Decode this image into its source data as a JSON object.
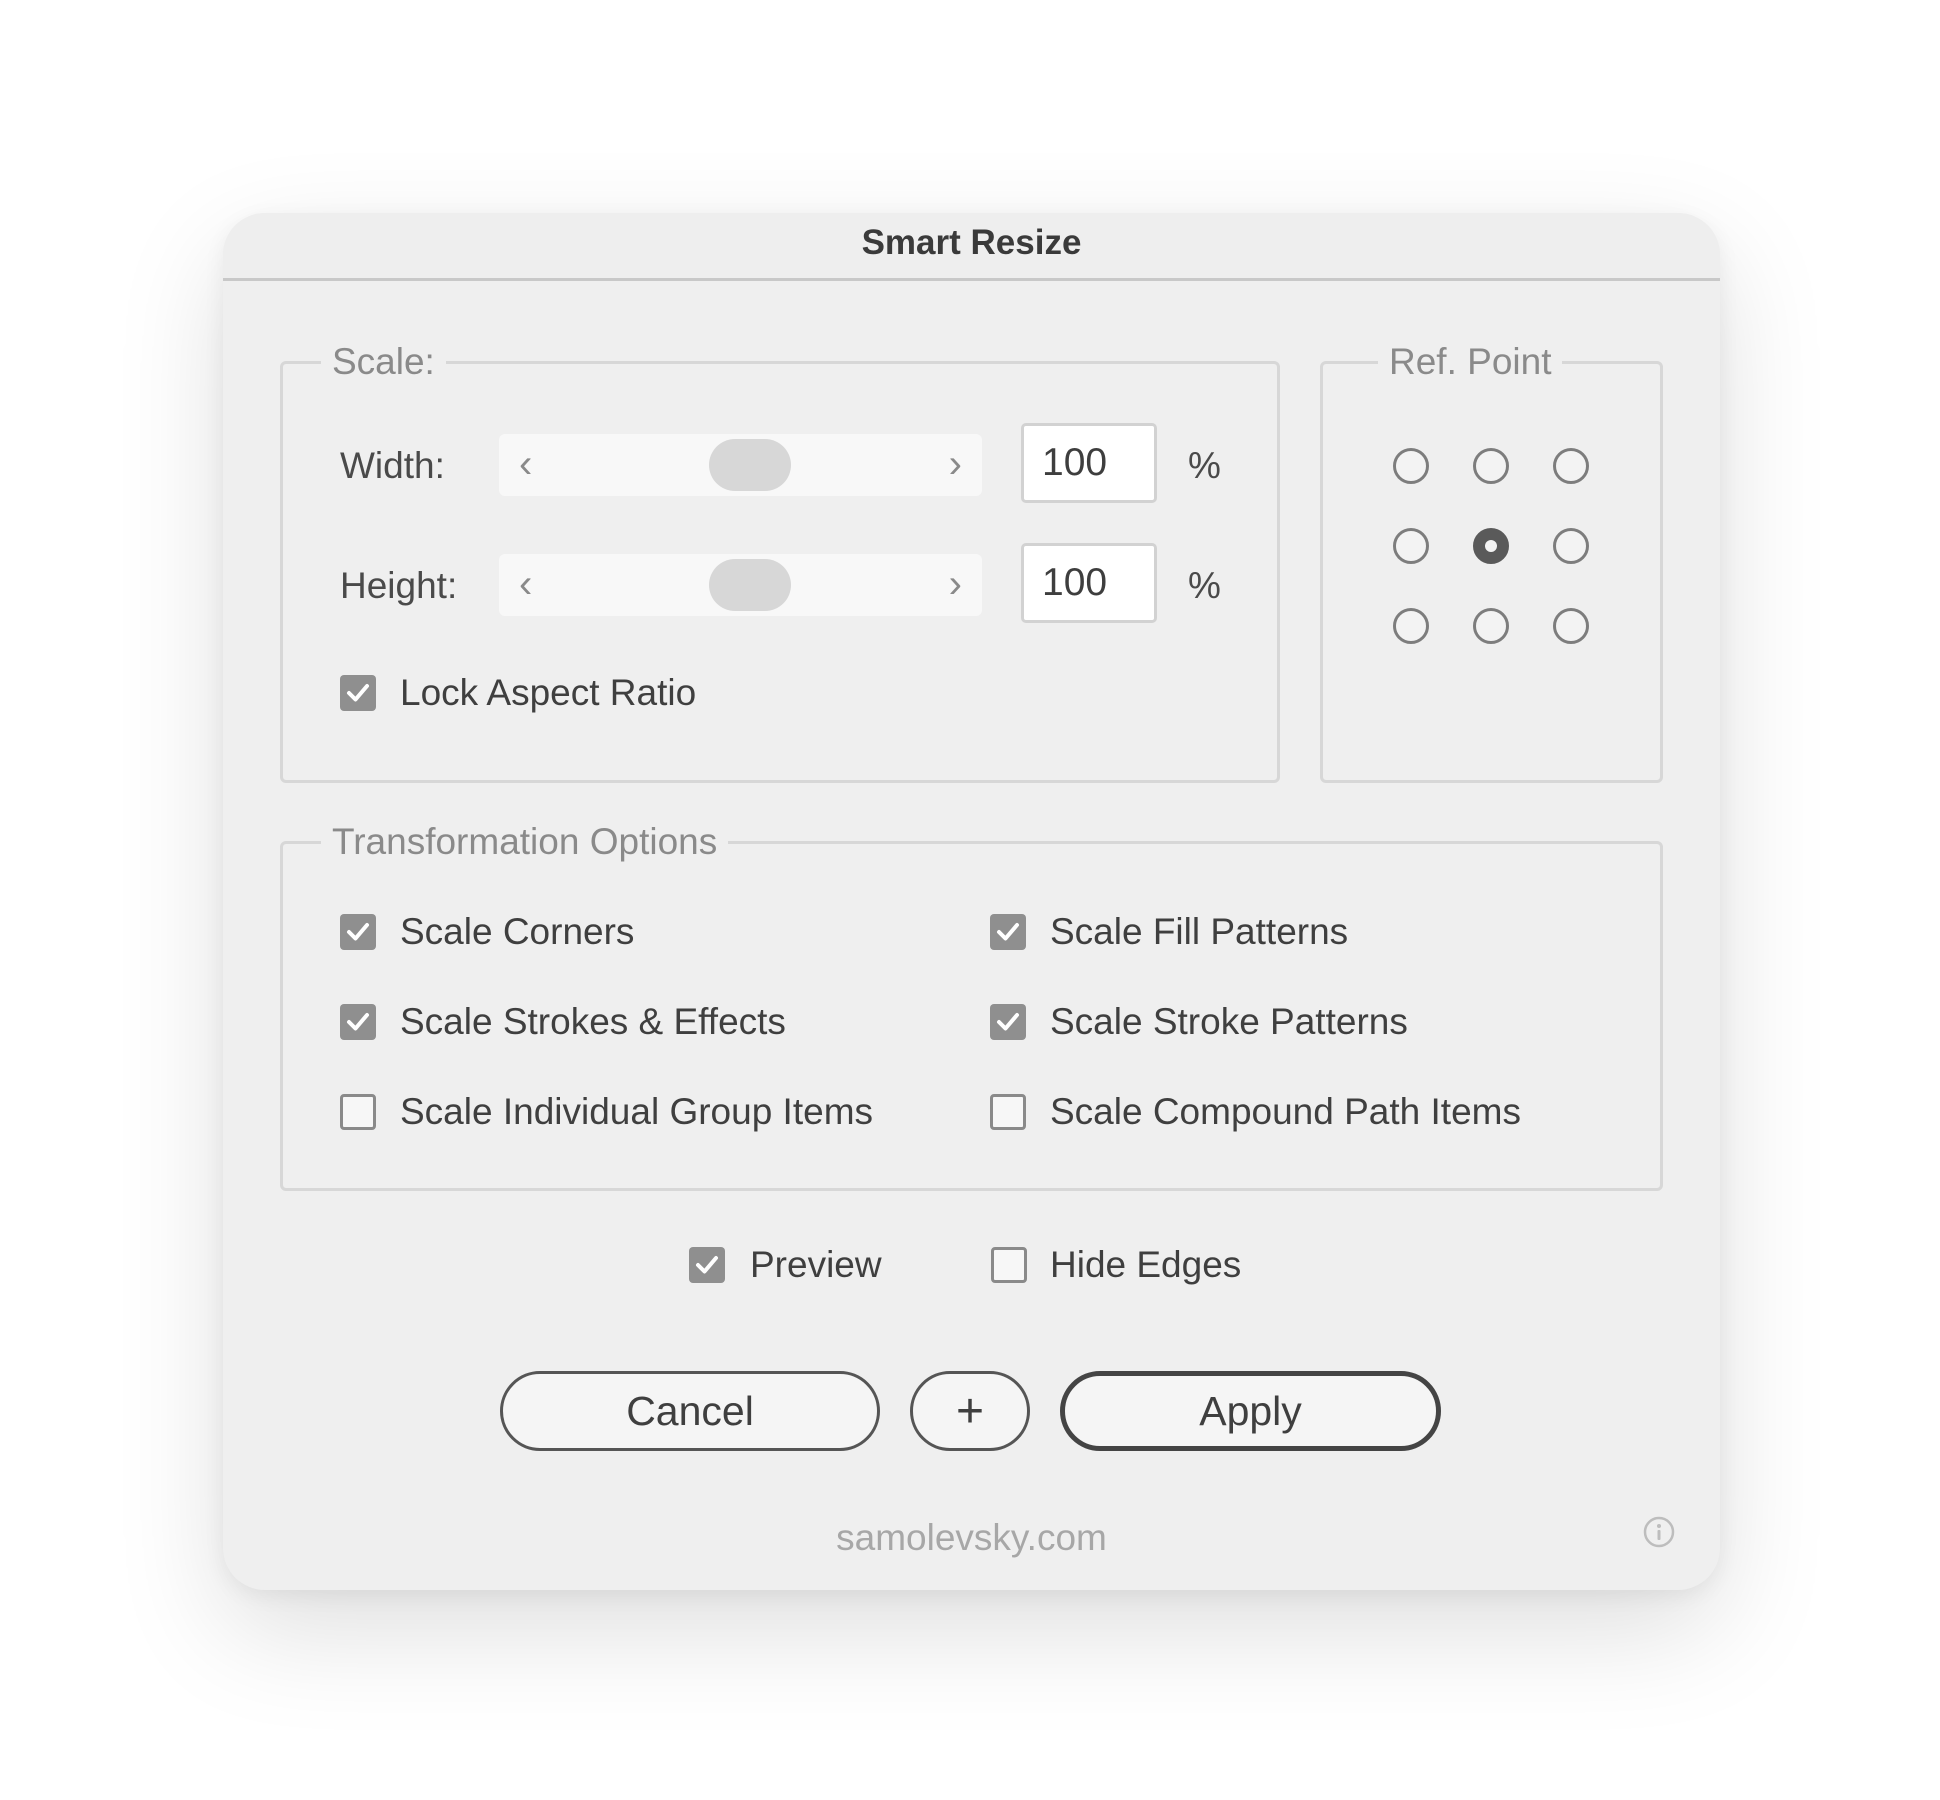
{
  "dialog": {
    "title": "Smart Resize",
    "scale_group": {
      "legend": "Scale:",
      "width": {
        "label": "Width:",
        "value": "100",
        "unit": "%"
      },
      "height": {
        "label": "Height:",
        "value": "100",
        "unit": "%"
      },
      "lock_aspect": {
        "label": "Lock Aspect Ratio",
        "checked": true
      }
    },
    "ref_point": {
      "legend": "Ref. Point",
      "selected": "middle-center"
    },
    "transform_group": {
      "legend": "Transformation Options",
      "options": [
        {
          "label": "Scale Corners",
          "checked": true
        },
        {
          "label": "Scale Fill Patterns",
          "checked": true
        },
        {
          "label": "Scale Strokes & Effects",
          "checked": true
        },
        {
          "label": "Scale Stroke Patterns",
          "checked": true
        },
        {
          "label": "Scale Individual Group Items",
          "checked": false
        },
        {
          "label": "Scale Compound Path Items",
          "checked": false
        }
      ]
    },
    "preview": {
      "label": "Preview",
      "checked": true
    },
    "hide_edges": {
      "label": "Hide Edges",
      "checked": false
    },
    "buttons": {
      "cancel": "Cancel",
      "add": "+",
      "apply": "Apply"
    },
    "footer": "samolevsky.com",
    "slider_arrows": {
      "left": "‹",
      "right": "›"
    }
  },
  "icons": {
    "info": "info-icon",
    "checkmark": "checkmark-icon"
  },
  "colors": {
    "dialog_bg": "#efefef",
    "checkbox_checked": "#8f8f8f",
    "text": "#444444"
  }
}
